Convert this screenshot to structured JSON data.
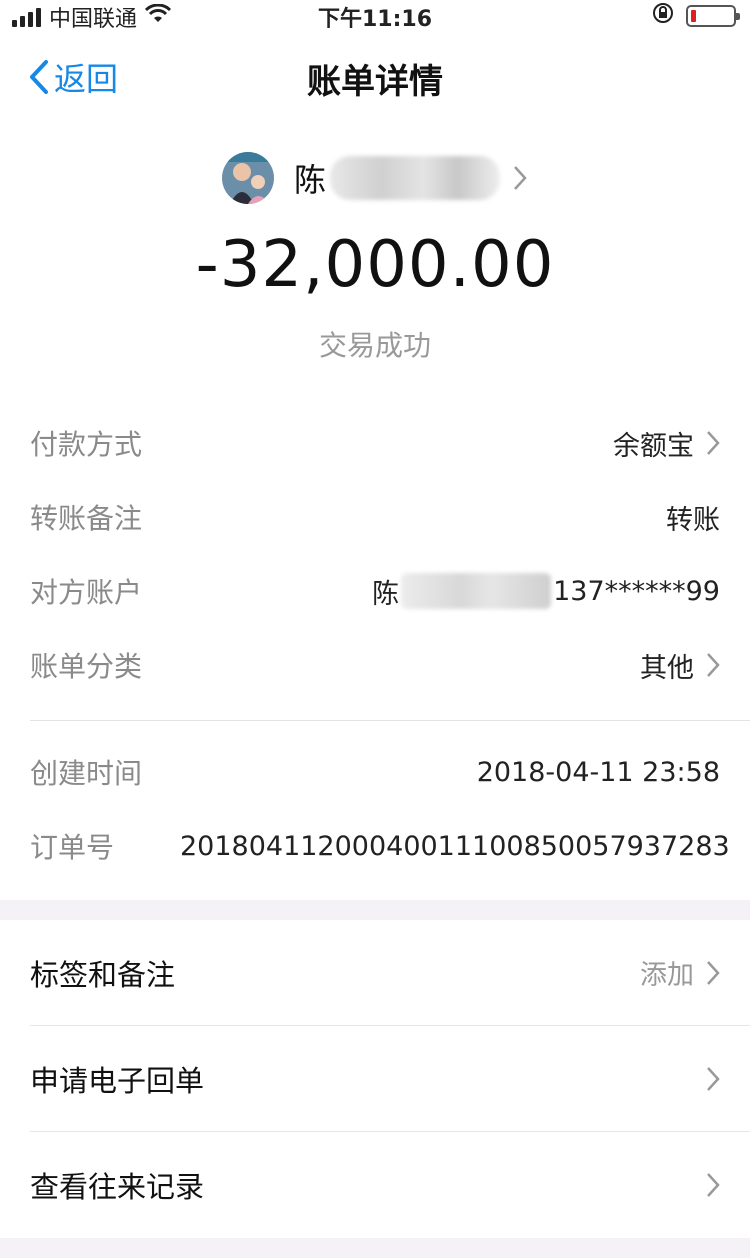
{
  "status_bar": {
    "carrier": "中国联通",
    "time": "下午11:16"
  },
  "nav": {
    "back_label": "返回",
    "title": "账单详情"
  },
  "header": {
    "payee_name": "陈",
    "amount": "-32,000.00",
    "status": "交易成功"
  },
  "details": [
    {
      "label": "付款方式",
      "value": "余额宝"
    },
    {
      "label": "转账备注",
      "value": "转账"
    },
    {
      "label": "对方账户",
      "value_prefix": "陈",
      "value_suffix": "137******99"
    },
    {
      "label": "账单分类",
      "value": "其他"
    }
  ],
  "meta": [
    {
      "label": "创建时间",
      "value": "2018-04-11 23:58"
    },
    {
      "label": "订单号",
      "value": "20180411200040011100850057937283"
    }
  ],
  "actions": [
    {
      "label": "标签和备注",
      "value": "添加"
    },
    {
      "label": "申请电子回单",
      "value": ""
    },
    {
      "label": "查看往来记录",
      "value": ""
    }
  ],
  "colors": {
    "accent": "#1688e8",
    "muted": "#8a8a8a",
    "background": "#f4f2f6"
  }
}
